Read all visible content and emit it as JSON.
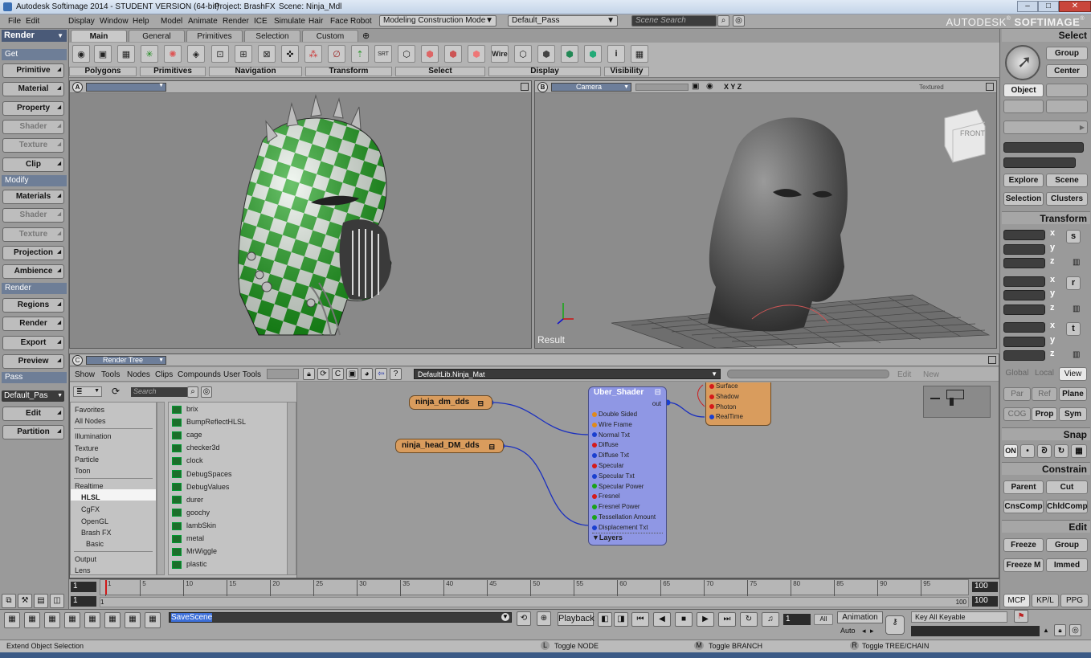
{
  "window": {
    "title": "Autodesk Softimage 2014  -  STUDENT VERSION (64-bit)",
    "project": "Project: BrashFX",
    "scene": "Scene: Ninja_Mdl",
    "brand_prefix": "AUTODESK",
    "brand": "SOFTIMAGE"
  },
  "menu": [
    "File",
    "Edit",
    "Display",
    "Window",
    "Help",
    "Model",
    "Animate",
    "Render",
    "ICE",
    "Simulate",
    "Hair",
    "Face Robot"
  ],
  "mode_dropdown": "Modeling Construction Mode",
  "pass_dropdown": "Default_Pass",
  "scene_search_placeholder": "Scene Search",
  "tabs": [
    "Main",
    "General",
    "Primitives",
    "Selection",
    "Custom"
  ],
  "toolbar_groups": [
    "Polygons",
    "Primitives",
    "Navigation",
    "Transform",
    "Select",
    "Display",
    "Visibility"
  ],
  "toolbar_wire": "Wire",
  "left_panel": {
    "module": "Render",
    "get_header": "Get",
    "get_items": [
      {
        "l": "Primitive",
        "d": false
      },
      {
        "l": "Material",
        "d": false
      },
      {
        "l": "Property",
        "d": false
      },
      {
        "l": "Shader",
        "d": true
      },
      {
        "l": "Texture",
        "d": true
      },
      {
        "l": "Clip",
        "d": false
      }
    ],
    "modify_header": "Modify",
    "modify_items": [
      {
        "l": "Materials",
        "d": false
      },
      {
        "l": "Shader",
        "d": true
      },
      {
        "l": "Texture",
        "d": true
      },
      {
        "l": "Projection",
        "d": false
      },
      {
        "l": "Ambience",
        "d": false
      }
    ],
    "render_header": "Render",
    "render_items": [
      {
        "l": "Regions",
        "d": false
      },
      {
        "l": "Render",
        "d": false
      },
      {
        "l": "Export",
        "d": false
      },
      {
        "l": "Preview",
        "d": false
      }
    ],
    "pass_header": "Pass",
    "pass_value": "Default_Pas",
    "pass_items": [
      "Edit",
      "Partition"
    ]
  },
  "viewport_a": {
    "letter": "A"
  },
  "viewport_b": {
    "letter": "B",
    "camera": "Camera",
    "xyz": "X  Y  Z",
    "mode": "Textured",
    "cube_label": "FRONT",
    "result": "Result"
  },
  "right_panel": {
    "select_header": "Select",
    "group": "Group",
    "center": "Center",
    "object": "Object",
    "explore": "Explore",
    "scene": "Scene",
    "selection": "Selection",
    "clusters": "Clusters",
    "transform_header": "Transform",
    "axes": [
      "x",
      "y",
      "z"
    ],
    "transform_btns": [
      "s",
      "r",
      "t"
    ],
    "global": "Global",
    "local": "Local",
    "view": "View",
    "par": "Par",
    "ref": "Ref",
    "plane": "Plane",
    "cog": "COG",
    "prop": "Prop",
    "sym": "Sym",
    "snap_header": "Snap",
    "snap_on": "ON",
    "constrain_header": "Constrain",
    "parent": "Parent",
    "cut": "Cut",
    "cnscomp": "CnsComp",
    "chldcomp": "ChldComp",
    "edit_header": "Edit",
    "freeze": "Freeze",
    "group2": "Group",
    "freezem": "Freeze M",
    "immed": "Immed",
    "tabs": [
      "MCP",
      "KP/L",
      "PPG"
    ]
  },
  "render_tree": {
    "title": "Render Tree",
    "menu": [
      "Show",
      "Tools",
      "Nodes",
      "Clips",
      "Compounds",
      "User Tools"
    ],
    "material": "DefaultLib.Ninja_Mat",
    "edit": "Edit",
    "new": "New",
    "search_placeholder": "Search",
    "categories": [
      "Favorites",
      "All Nodes",
      "Illumination",
      "Texture",
      "Particle",
      "Toon",
      "Realtime",
      "HLSL",
      "CgFX",
      "OpenGL",
      "Brash FX",
      "Basic",
      "Output",
      "Lens"
    ],
    "presets": [
      "brix",
      "BumpReflectHLSL",
      "cage",
      "checker3d",
      "clock",
      "DebugSpaces",
      "DebugValues",
      "durer",
      "goochy",
      "lambSkin",
      "metal",
      "MrWiggle",
      "plastic"
    ],
    "node1": "ninja_dm_dds",
    "node2": "ninja_head_DM_dds",
    "shader_title": "Uber_Shader",
    "shader_out": "out",
    "shader_ports": [
      {
        "n": "Double Sided",
        "c": "#e08a1a"
      },
      {
        "n": "Wire Frame",
        "c": "#e08a1a"
      },
      {
        "n": "Normal Txt",
        "c": "#1a3fcf"
      },
      {
        "n": "Diffuse",
        "c": "#d41a1a"
      },
      {
        "n": "Diffuse Txt",
        "c": "#1a3fcf"
      },
      {
        "n": "Specular",
        "c": "#d41a1a"
      },
      {
        "n": "Specular Txt",
        "c": "#1a3fcf"
      },
      {
        "n": "Specular Power",
        "c": "#19a319"
      },
      {
        "n": "Fresnel",
        "c": "#d41a1a"
      },
      {
        "n": "Fresnel Power",
        "c": "#19a319"
      },
      {
        "n": "Tessellation Amount",
        "c": "#19a319"
      },
      {
        "n": "Displacement Txt",
        "c": "#1a3fcf"
      }
    ],
    "layers": "▼Layers",
    "material_ports": [
      {
        "n": "Surface",
        "c": "#d41a1a"
      },
      {
        "n": "Shadow",
        "c": "#d41a1a"
      },
      {
        "n": "Photon",
        "c": "#d41a1a"
      },
      {
        "n": "RealTime",
        "c": "#1a3fcf"
      }
    ]
  },
  "timeline": {
    "start": "1",
    "end": "100",
    "current": "1",
    "range_start": "1",
    "range_end": "100",
    "marks": [
      "1",
      "5",
      "10",
      "15",
      "20",
      "25",
      "30",
      "35",
      "40",
      "45",
      "50",
      "55",
      "60",
      "65",
      "70",
      "75",
      "80",
      "85",
      "90",
      "95"
    ],
    "end_small": "100"
  },
  "bottom": {
    "command": "SaveScene",
    "playback": "Playback",
    "frame": "1",
    "all": "All",
    "animation": "Animation",
    "auto": "Auto",
    "key_all": "Key All Keyable"
  },
  "status": {
    "left": "Extend Object Selection",
    "l_key": "L",
    "l_label": "Toggle NODE",
    "m_key": "M",
    "m_label": "Toggle BRANCH",
    "r_key": "R",
    "r_label": "Toggle TREE/CHAIN"
  }
}
